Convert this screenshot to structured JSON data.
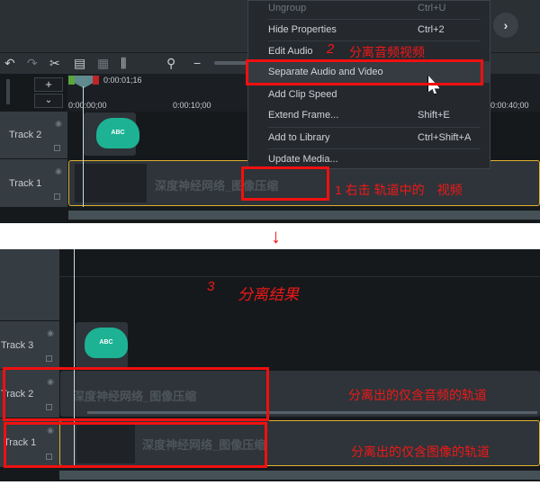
{
  "top": {
    "timecode": "0:00:01;16",
    "ruler": [
      "0:00:00;00",
      "0:00:10;00",
      "0:00:40;00"
    ],
    "tracks": [
      {
        "label": "Track 2"
      },
      {
        "label": "Track 1"
      }
    ],
    "clip_title": "深度神经网络_图像压缩",
    "callout_abc": "ABC",
    "menu": [
      {
        "label": "Ungroup",
        "shortcut": "Ctrl+U",
        "disabled": true
      },
      {
        "label": "Hide Properties",
        "shortcut": "Ctrl+2"
      },
      {
        "label": "Edit Audio",
        "shortcut": ""
      },
      {
        "label": "Separate Audio and Video",
        "shortcut": "",
        "highlighted": true
      },
      {
        "label": "Add Clip Speed",
        "shortcut": ""
      },
      {
        "label": "Extend Frame...",
        "shortcut": "Shift+E"
      },
      {
        "label": "Add to Library",
        "shortcut": "Ctrl+Shift+A"
      },
      {
        "label": "Update Media...",
        "shortcut": ""
      }
    ],
    "annotations": {
      "step1": "1 右击 轨道中的　视频",
      "step2": "2",
      "step2_text": "分离音频视频"
    }
  },
  "bottom": {
    "tracks": [
      {
        "label": "Track 3"
      },
      {
        "label": "Track 2"
      },
      {
        "label": "Track 1"
      }
    ],
    "clip_title": "深度神经网络_图像压缩",
    "callout_abc": "ABC",
    "annotations": {
      "step3": "3",
      "step3_text": "分离结果",
      "audio_track": "分离出的仅含音频的轨道",
      "video_track": "分离出的仅含图像的轨道"
    }
  },
  "colors": {
    "accent_red": "#f01010",
    "clip_border": "#e0b030",
    "callout": "#1db294"
  }
}
